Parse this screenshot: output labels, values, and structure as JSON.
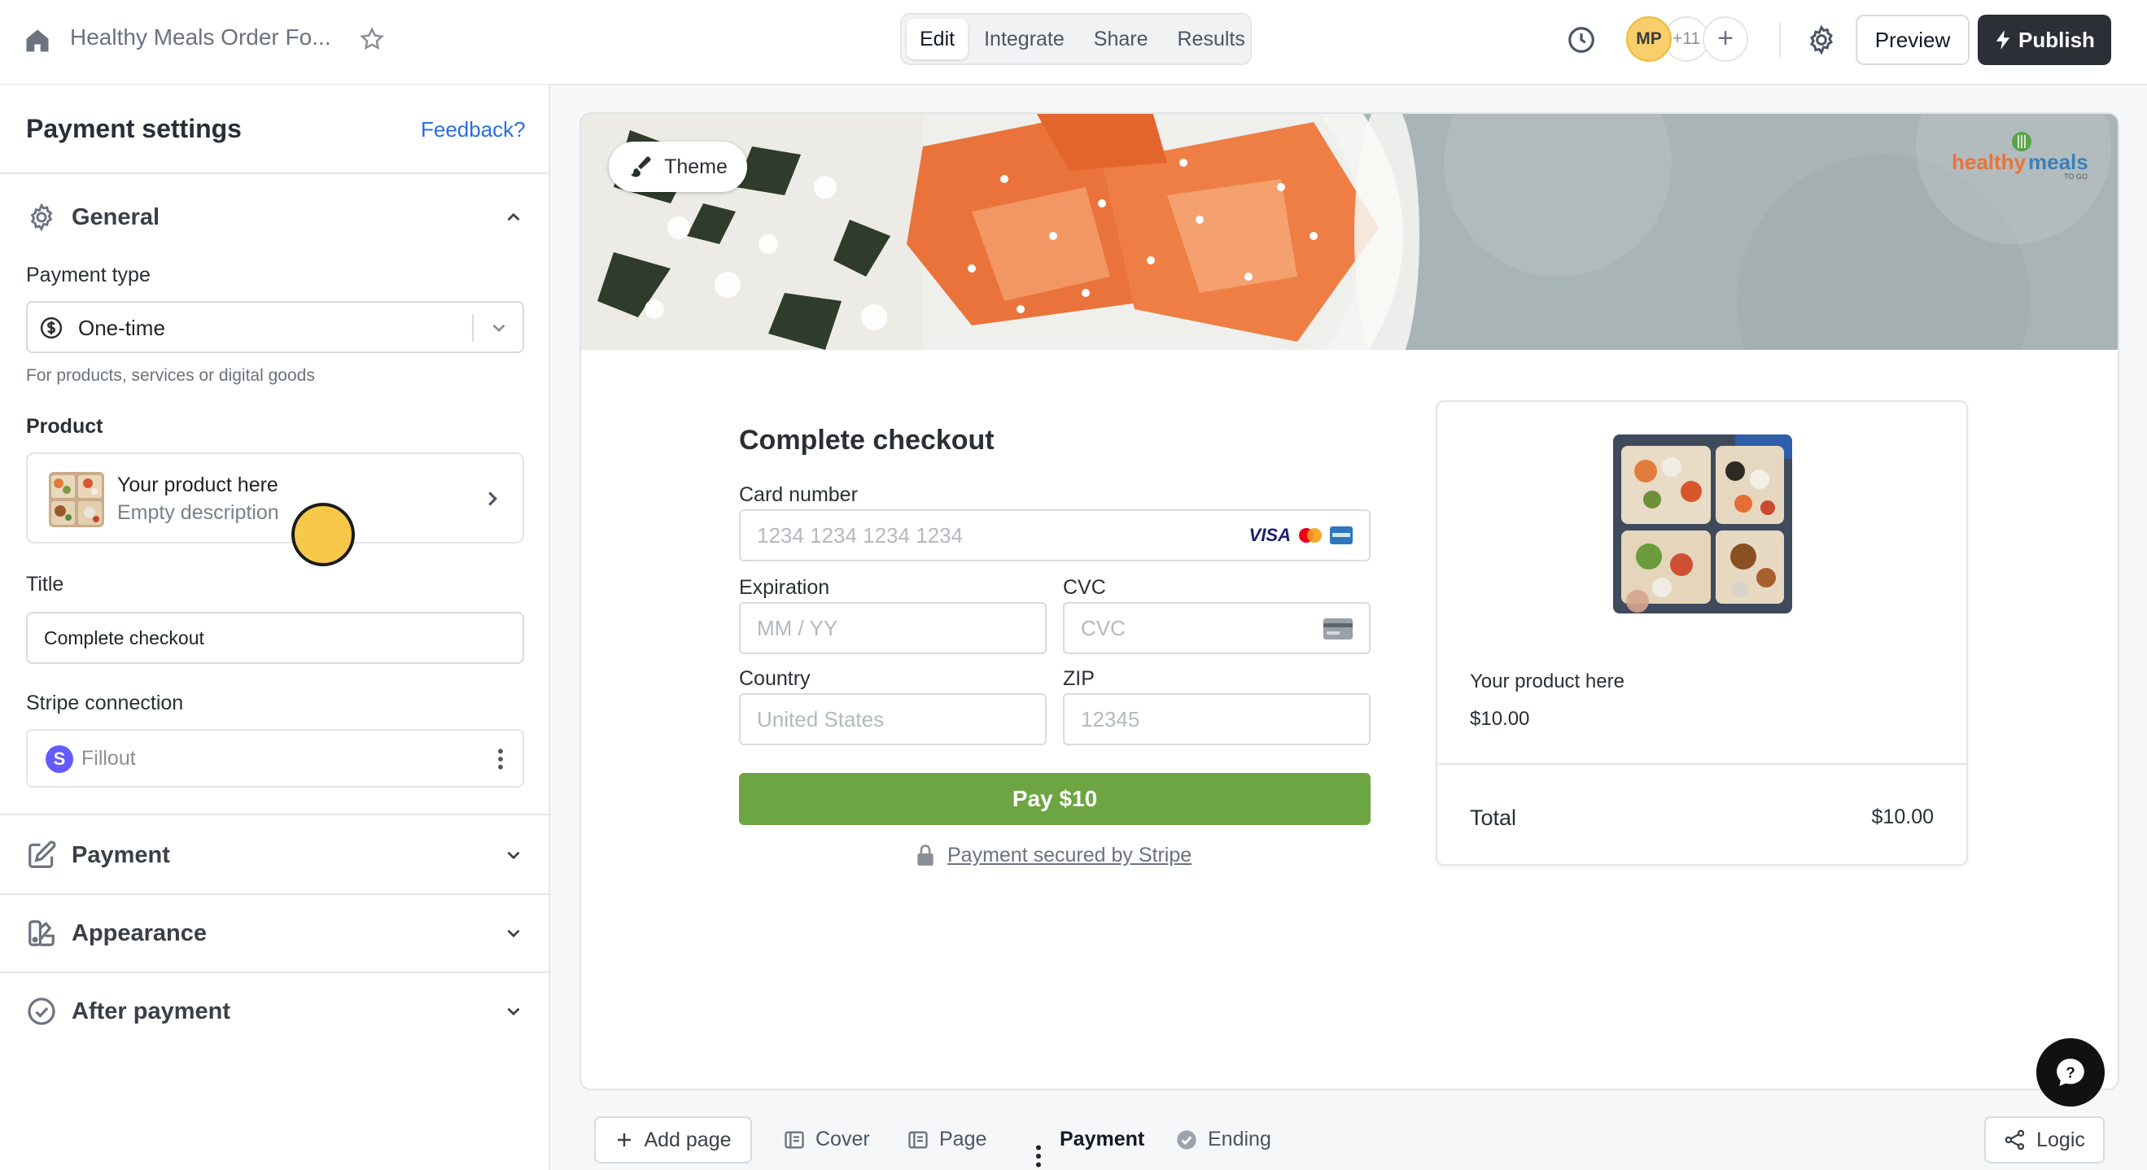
{
  "topbar": {
    "form_title": "Healthy Meals Order Fo...",
    "tabs": [
      {
        "label": "Edit",
        "active": true
      },
      {
        "label": "Integrate",
        "active": false
      },
      {
        "label": "Share",
        "active": false
      },
      {
        "label": "Results",
        "active": false
      }
    ],
    "avatar_initials": "MP",
    "more_collaborators": "+11",
    "preview_label": "Preview",
    "publish_label": "Publish"
  },
  "sidebar": {
    "title": "Payment settings",
    "feedback_label": "Feedback?",
    "general": {
      "label": "General",
      "payment_type_label": "Payment type",
      "payment_type_value": "One-time",
      "payment_type_help": "For products, services or digital goods",
      "product_label": "Product",
      "product_name": "Your product here",
      "product_description": "Empty description",
      "title_label": "Title",
      "title_value": "Complete checkout",
      "stripe_label": "Stripe connection",
      "stripe_account": "Fillout"
    },
    "sections": [
      {
        "label": "Payment",
        "icon": "edit-square-icon"
      },
      {
        "label": "Appearance",
        "icon": "palette-icon"
      },
      {
        "label": "After payment",
        "icon": "check-circle-icon"
      }
    ]
  },
  "theme_label": "Theme",
  "brand": {
    "name_left": "healthy",
    "name_right": "meals",
    "tagline": "TO GO"
  },
  "checkout": {
    "title": "Complete checkout",
    "card_label": "Card number",
    "card_placeholder": "1234 1234 1234 1234",
    "card_brand": "VISA",
    "expiration_label": "Expiration",
    "expiration_placeholder": "MM / YY",
    "cvc_label": "CVC",
    "cvc_placeholder": "CVC",
    "country_label": "Country",
    "country_placeholder": "United States",
    "zip_label": "ZIP",
    "zip_placeholder": "12345",
    "pay_label": "Pay $10",
    "secured_label": "Payment secured by Stripe"
  },
  "summary": {
    "product_name": "Your product here",
    "price": "$10.00",
    "total_label": "Total",
    "total_value": "$10.00"
  },
  "bottom": {
    "add_page": "Add page",
    "pages": [
      {
        "label": "Cover",
        "active": false
      },
      {
        "label": "Page",
        "active": false
      },
      {
        "label": "Payment",
        "active": true
      },
      {
        "label": "Ending",
        "active": false
      }
    ],
    "logic": "Logic"
  },
  "colors": {
    "accent_blue": "#2a6ede",
    "pay_green": "#6da542",
    "publish_dark": "#2b2f36",
    "stripe_purple": "#635bff"
  }
}
